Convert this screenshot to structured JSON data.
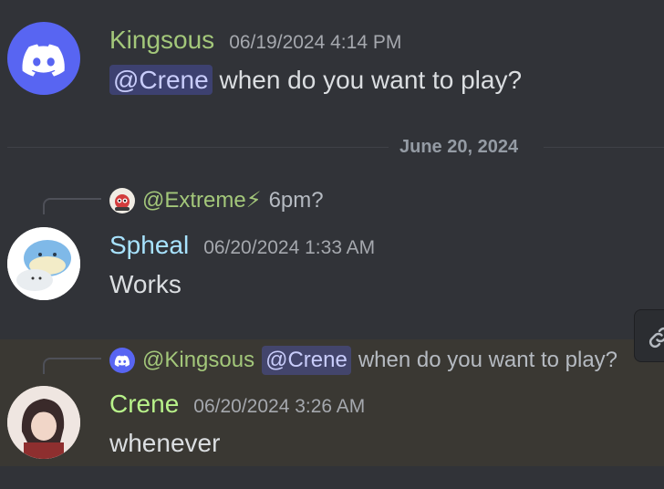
{
  "messages": [
    {
      "username": "Kingsous",
      "timestamp": "06/19/2024 4:14 PM",
      "mention": "@Crene",
      "text": "when do you want to play?"
    }
  ],
  "date_divider": "June 20, 2024",
  "reply1": {
    "name": "@Extreme",
    "badge": "⚡",
    "text": "6pm?"
  },
  "message2": {
    "username": "Spheal",
    "timestamp": "06/20/2024 1:33 AM",
    "text": "Works"
  },
  "reply2": {
    "name": "@Kingsous",
    "mention": "@Crene",
    "text": "when do you want to play?"
  },
  "message3": {
    "username": "Crene",
    "timestamp": "06/20/2024 3:26 AM",
    "text": "whenever"
  },
  "colors": {
    "background": "#313338",
    "hover": "#3a3833",
    "kingsous": "#a3c77a",
    "spheal": "#a8e3ff",
    "crene": "#b8f28a",
    "mention_bg": "rgba(88,101,242,0.3)",
    "blurple": "#5865f2"
  },
  "icons": {
    "discord_avatar": "discord-logo-icon",
    "hover_action": "link-icon"
  }
}
